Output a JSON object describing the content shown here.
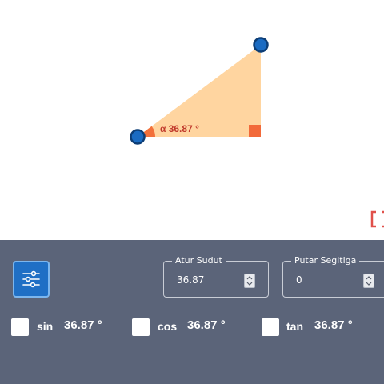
{
  "canvas": {
    "angle_label": "α 36.87 °",
    "colors": {
      "triangle_fill": "#ffd5a0",
      "angle_marker": "#f2703a",
      "right_angle_marker": "#f26a3a",
      "label_color": "#c0392b",
      "point_fill": "#1a6bc2",
      "point_stroke": "#0c3d75",
      "corner_bracket": "#e0504a"
    }
  },
  "panel": {
    "settings_icon": "sliders-icon",
    "angle_field": {
      "legend": "Atur Sudut",
      "value": "36.87"
    },
    "rotate_field": {
      "legend": "Putar Segitiga",
      "value": "0"
    },
    "trig": [
      {
        "fn": "sin",
        "value": "36.87 °"
      },
      {
        "fn": "cos",
        "value": "36.87 °"
      },
      {
        "fn": "tan",
        "value": "36.87 °"
      }
    ],
    "colors": {
      "background": "#5b6479",
      "accent": "#1f6fc5"
    }
  }
}
